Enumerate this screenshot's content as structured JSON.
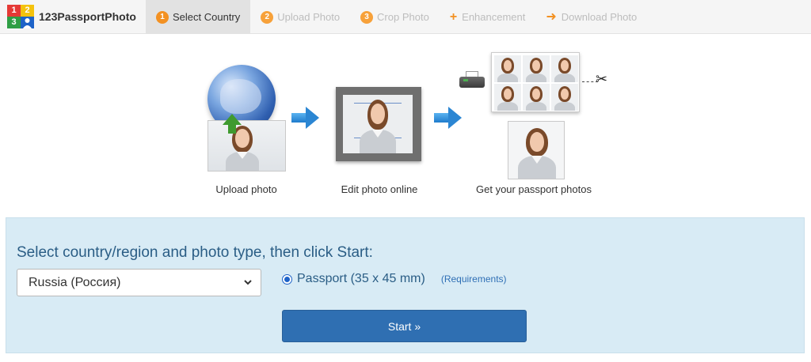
{
  "brand": {
    "logo_digits": [
      "1",
      "2",
      "3"
    ],
    "name": "123PassportPhoto"
  },
  "nav": {
    "tabs": [
      {
        "marker": "1",
        "label": "Select Country",
        "active": true
      },
      {
        "marker": "2",
        "label": "Upload Photo",
        "active": false
      },
      {
        "marker": "3",
        "label": "Crop Photo",
        "active": false
      },
      {
        "marker": "+",
        "label": "Enhancement",
        "active": false
      },
      {
        "marker": "➜",
        "label": "Download Photo",
        "active": false
      }
    ]
  },
  "steps": {
    "upload": "Upload photo",
    "edit": "Edit photo online",
    "get": "Get your passport photos"
  },
  "panel": {
    "title": "Select country/region and photo type, then click Start:",
    "country_selected": "Russia (Россия)",
    "photo_type": "Passport (35 x 45 mm)",
    "requirements_link": "(Requirements)",
    "start_label": "Start »"
  },
  "colors": {
    "accent_orange": "#f39122",
    "panel_bg": "#d8ebf5",
    "start_button": "#2f6fb2",
    "title_text": "#2a5d85"
  },
  "icons": {
    "globe": "globe-icon",
    "upload_arrow": "upload-arrow-icon",
    "step_arrow": "right-arrow-icon",
    "printer": "printer-icon",
    "scissors": "scissors-icon",
    "dropdown": "chevron-down-icon"
  }
}
